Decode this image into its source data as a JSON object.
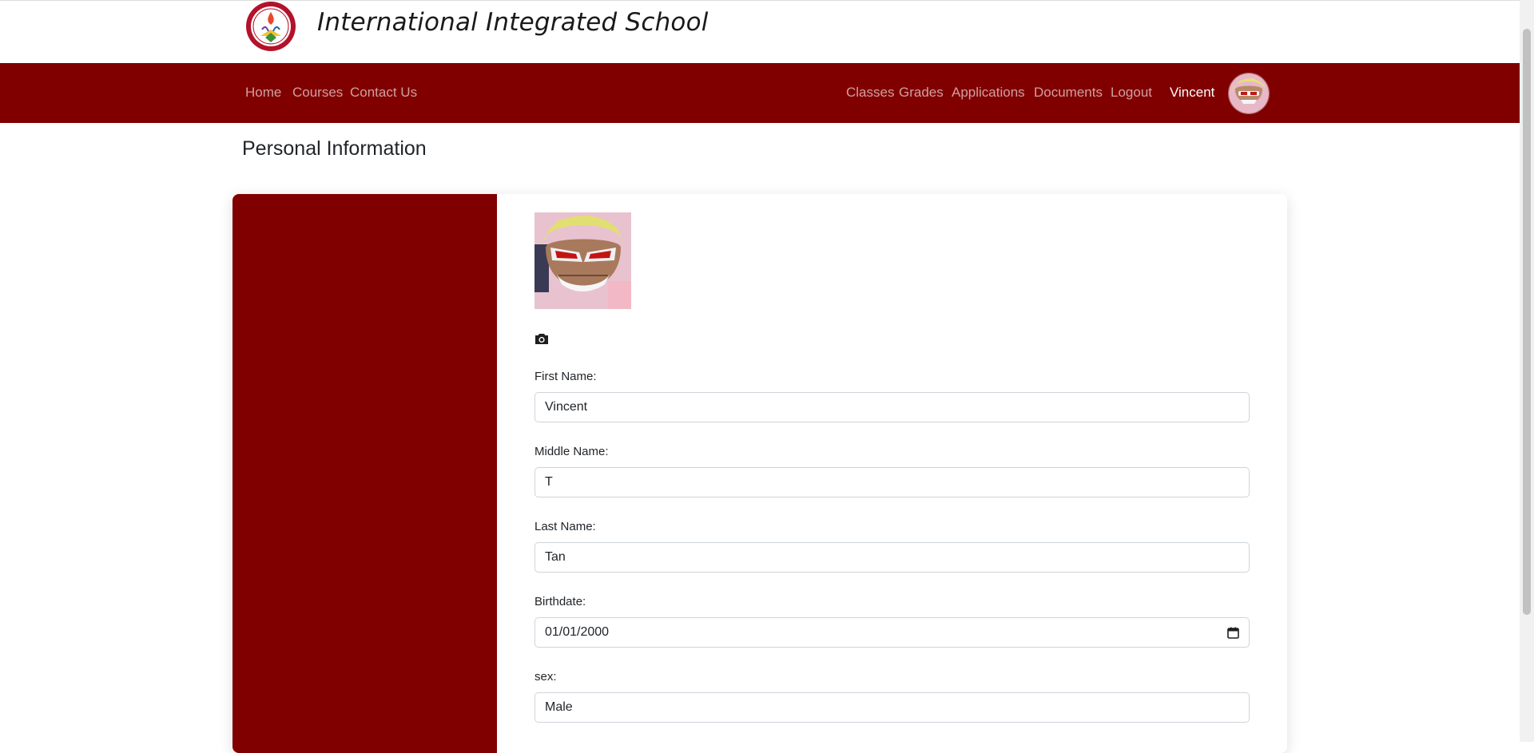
{
  "header": {
    "school_name": "International Integrated School"
  },
  "navbar": {
    "left_links": [
      "Home",
      "Courses",
      "Contact Us"
    ],
    "right_links": [
      "Classes",
      "Grades",
      "Applications",
      "Documents",
      "Logout"
    ],
    "user_name": "Vincent"
  },
  "page": {
    "title": "Personal Information"
  },
  "form": {
    "first_name": {
      "label": "First Name:",
      "value": "Vincent"
    },
    "middle_name": {
      "label": "Middle Name:",
      "value": "T"
    },
    "last_name": {
      "label": "Last Name:",
      "value": "Tan"
    },
    "birthdate": {
      "label": "Birthdate:",
      "value": "01/01/2000"
    },
    "sex": {
      "label": "sex:",
      "value": "Male"
    }
  },
  "colors": {
    "brand": "#800000",
    "nav_link": "#d9a3a3"
  },
  "icons": {
    "camera": "camera-icon",
    "calendar": "calendar-icon"
  }
}
